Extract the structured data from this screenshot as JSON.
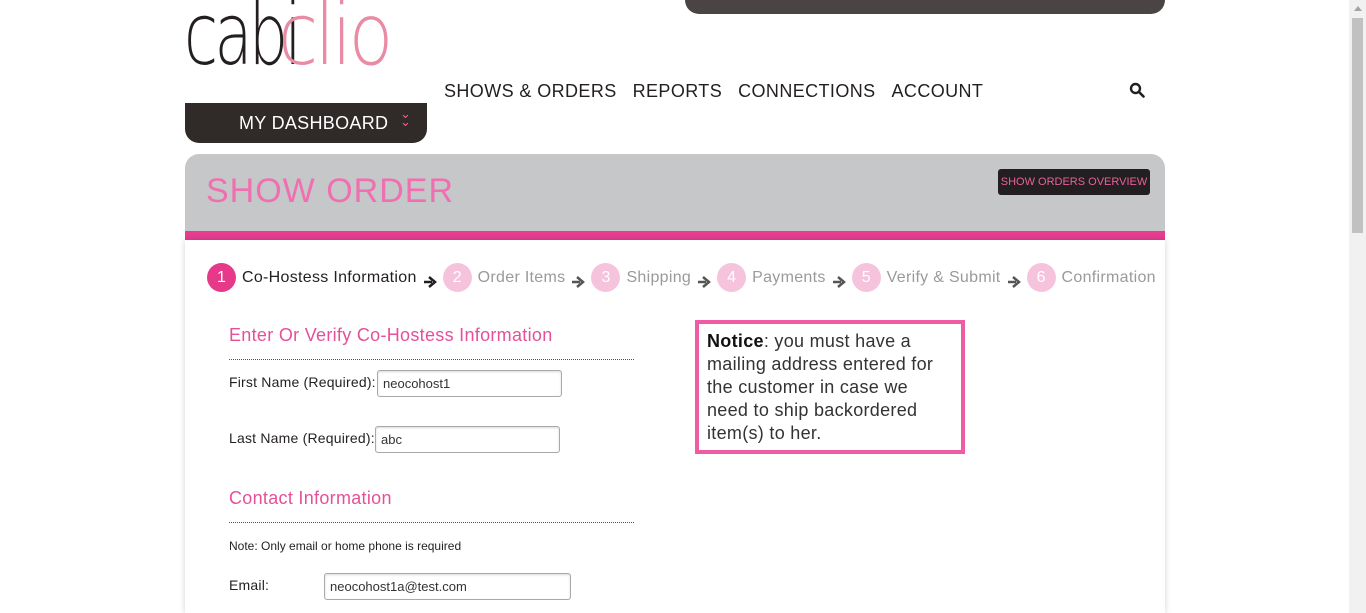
{
  "brand": {
    "cabi": "cabi",
    "clio": "clio"
  },
  "dashboard": {
    "label": "MY DASHBOARD"
  },
  "nav": [
    "SHOWS & ORDERS",
    "REPORTS",
    "CONNECTIONS",
    "ACCOUNT"
  ],
  "header": {
    "title": "SHOW ORDER",
    "overview_button": "SHOW ORDERS OVERVIEW"
  },
  "steps": [
    {
      "num": "1",
      "label": "Co-Hostess Information"
    },
    {
      "num": "2",
      "label": "Order Items"
    },
    {
      "num": "3",
      "label": "Shipping"
    },
    {
      "num": "4",
      "label": "Payments"
    },
    {
      "num": "5",
      "label": "Verify & Submit"
    },
    {
      "num": "6",
      "label": "Confirmation"
    }
  ],
  "form": {
    "section1_title": "Enter Or Verify Co-Hostess Information",
    "first_name_label": "First Name (Required):",
    "first_name_value": "neocohost1",
    "last_name_label": "Last Name (Required):",
    "last_name_value": "abc",
    "section2_title": "Contact Information",
    "note": "Note: Only email or home phone is required",
    "email_label": "Email:",
    "email_value": "neocohost1a@test.com"
  },
  "notice": {
    "heading": "Notice",
    "text": ": you must have a mailing address entered for the customer in case we need to ship backordered item(s) to her."
  },
  "colors": {
    "accent": "#e63d8f",
    "pink_light": "#f6c3dc",
    "dark": "#231f20",
    "band": "#c6c7c9"
  }
}
